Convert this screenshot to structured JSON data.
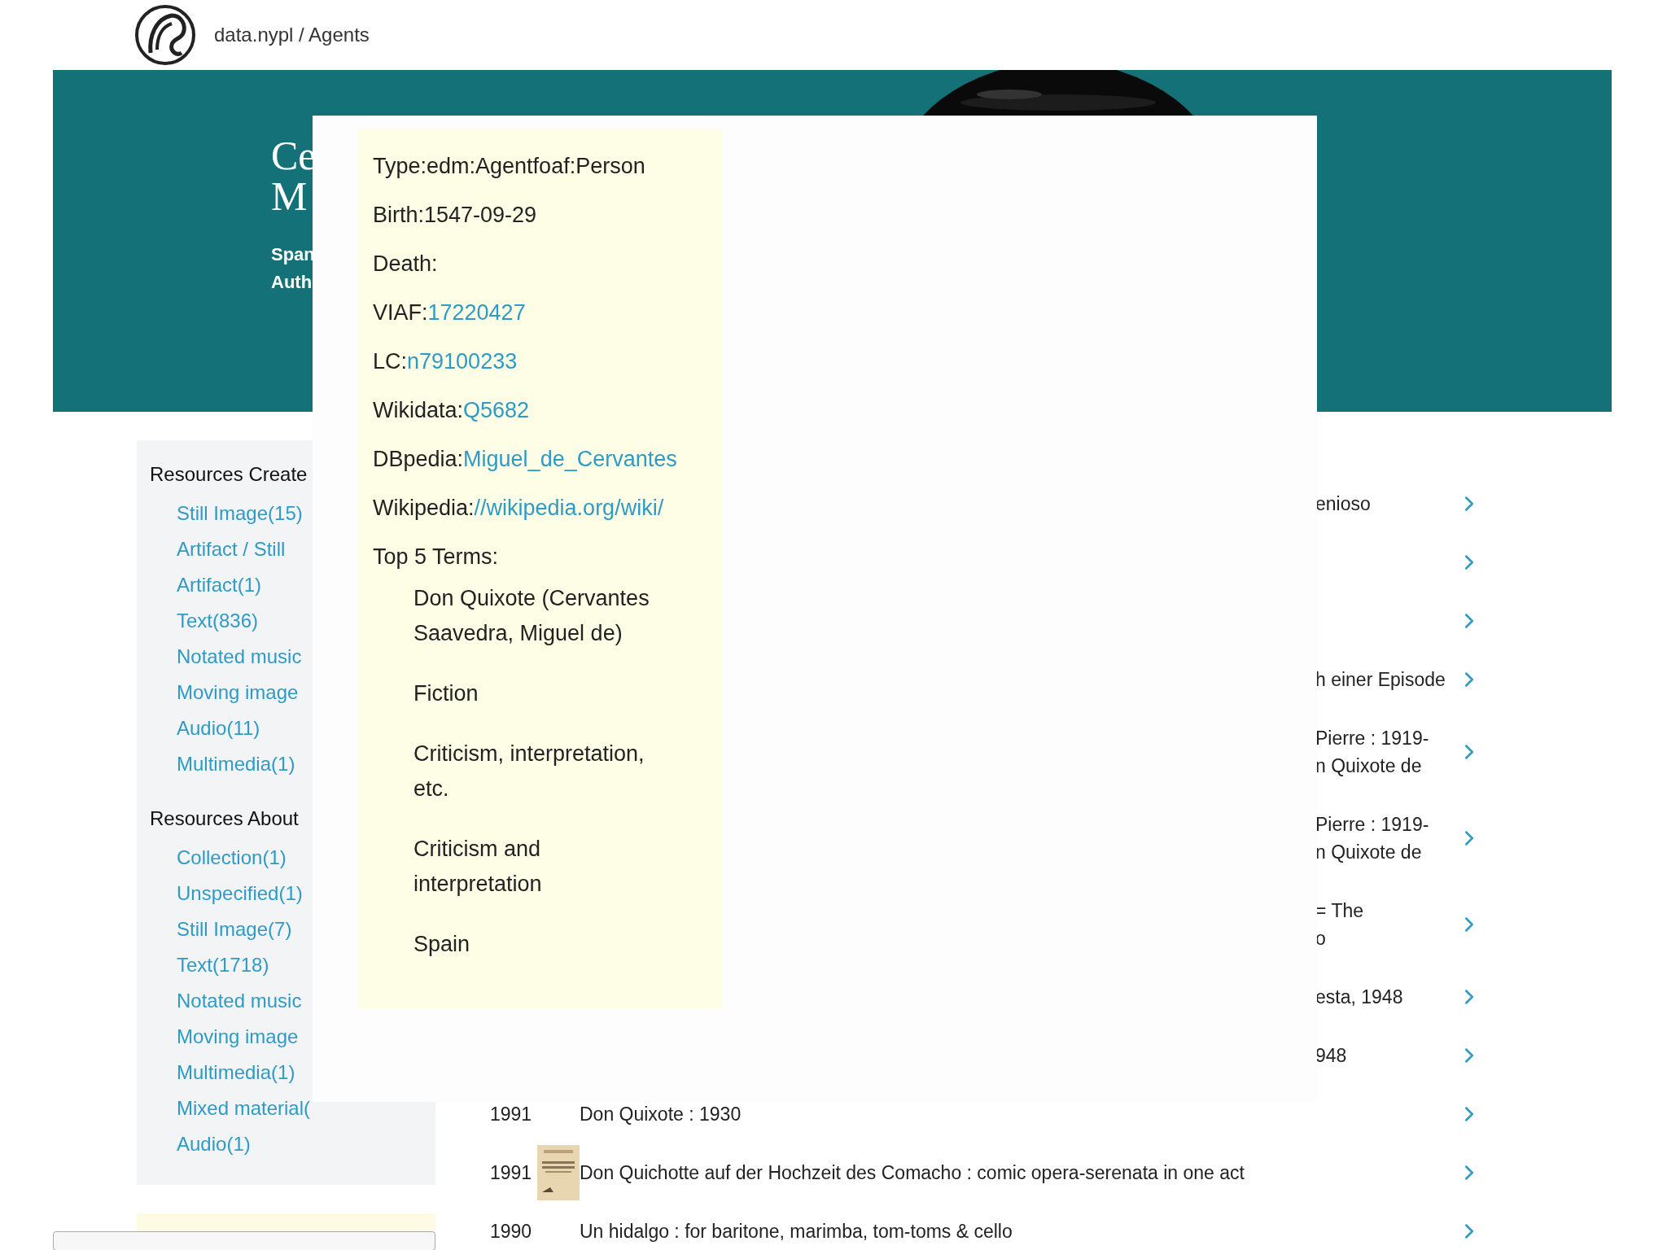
{
  "header": {
    "brand": "data.nypl / Agents"
  },
  "hero": {
    "title_lines": [
      "Ce",
      "M"
    ],
    "subtitle_lines": [
      "Span",
      "Auth"
    ]
  },
  "sidebar": {
    "sections": [
      {
        "heading": "Resources Create",
        "items": [
          "Still Image(15)",
          "Artifact / Still",
          "Artifact(1)",
          "Text(836)",
          "Notated music",
          "Moving image",
          "Audio(11)",
          "Multimedia(1)"
        ]
      },
      {
        "heading": "Resources About",
        "items": [
          "Collection(1)",
          "Unspecified(1)",
          "Still Image(7)",
          "Text(1718)",
          "Notated music",
          "Moving image",
          "Multimedia(1)",
          "Mixed material(",
          "Audio(1)"
        ]
      }
    ]
  },
  "results": [
    {
      "kind": "partial",
      "lines": [
        "enioso"
      ]
    },
    {
      "kind": "partial"
    },
    {
      "kind": "partial"
    },
    {
      "kind": "partial",
      "lines": [
        "h einer Episode"
      ]
    },
    {
      "kind": "partial",
      "lines": [
        "Pierre : 1919-",
        "n Quixote de"
      ]
    },
    {
      "kind": "partial",
      "lines": [
        "Pierre : 1919-",
        "n Quixote de"
      ]
    },
    {
      "kind": "partial",
      "lines": [
        "= The",
        "o"
      ]
    },
    {
      "kind": "partial",
      "lines": [
        "esta, 1948"
      ]
    },
    {
      "kind": "partial",
      "lines": [
        "948"
      ]
    },
    {
      "kind": "full",
      "year": "1991",
      "title": "Don Quixote : 1930"
    },
    {
      "kind": "full",
      "year": "1991",
      "title": "Don Quichotte auf der Hochzeit des Comacho : comic opera-serenata in one act"
    },
    {
      "kind": "full",
      "year": "1990",
      "title": "Un hidalgo : for baritone, marimba, tom-toms & cello"
    }
  ],
  "popup": {
    "fields": [
      {
        "kind": "text",
        "text": "Type:edm:Agentfoaf:Person"
      },
      {
        "kind": "text",
        "text": "Birth:1547-09-29"
      },
      {
        "kind": "text",
        "text": "Death:"
      },
      {
        "kind": "link",
        "label": "VIAF:",
        "link": "17220427"
      },
      {
        "kind": "link",
        "label": "LC:",
        "link": "n79100233"
      },
      {
        "kind": "link",
        "label": "Wikidata:",
        "link": "Q5682"
      },
      {
        "kind": "link",
        "label": "DBpedia:",
        "link": "Miguel_de_Cervantes"
      },
      {
        "kind": "link",
        "label": "Wikipedia:",
        "link": "//wikipedia.org/wiki/"
      }
    ],
    "terms_heading": "Top 5 Terms:",
    "terms": [
      "Don Quixote (Cervantes Saavedra, Miguel de)",
      "Fiction",
      "Criticism, interpretation, etc.",
      "Criticism and interpretation",
      "Spain"
    ]
  }
}
